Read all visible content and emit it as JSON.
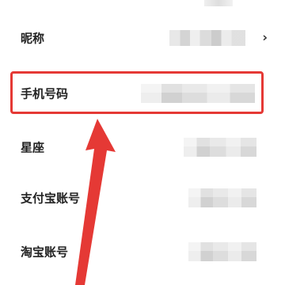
{
  "profile_fields": [
    {
      "label": "昵称",
      "has_chevron": true,
      "chevron": "›"
    },
    {
      "label": "手机号码",
      "has_chevron": false
    },
    {
      "label": "星座",
      "has_chevron": false
    },
    {
      "label": "支付宝账号",
      "has_chevron": false
    },
    {
      "label": "淘宝账号",
      "has_chevron": false
    }
  ],
  "annotation": {
    "highlight_color": "#e53935",
    "highlighted_field": "手机号码",
    "arrow_color": "#e53935"
  },
  "icons": {
    "chevron": "chevron-right-icon",
    "arrow": "red-arrow-up-icon"
  }
}
